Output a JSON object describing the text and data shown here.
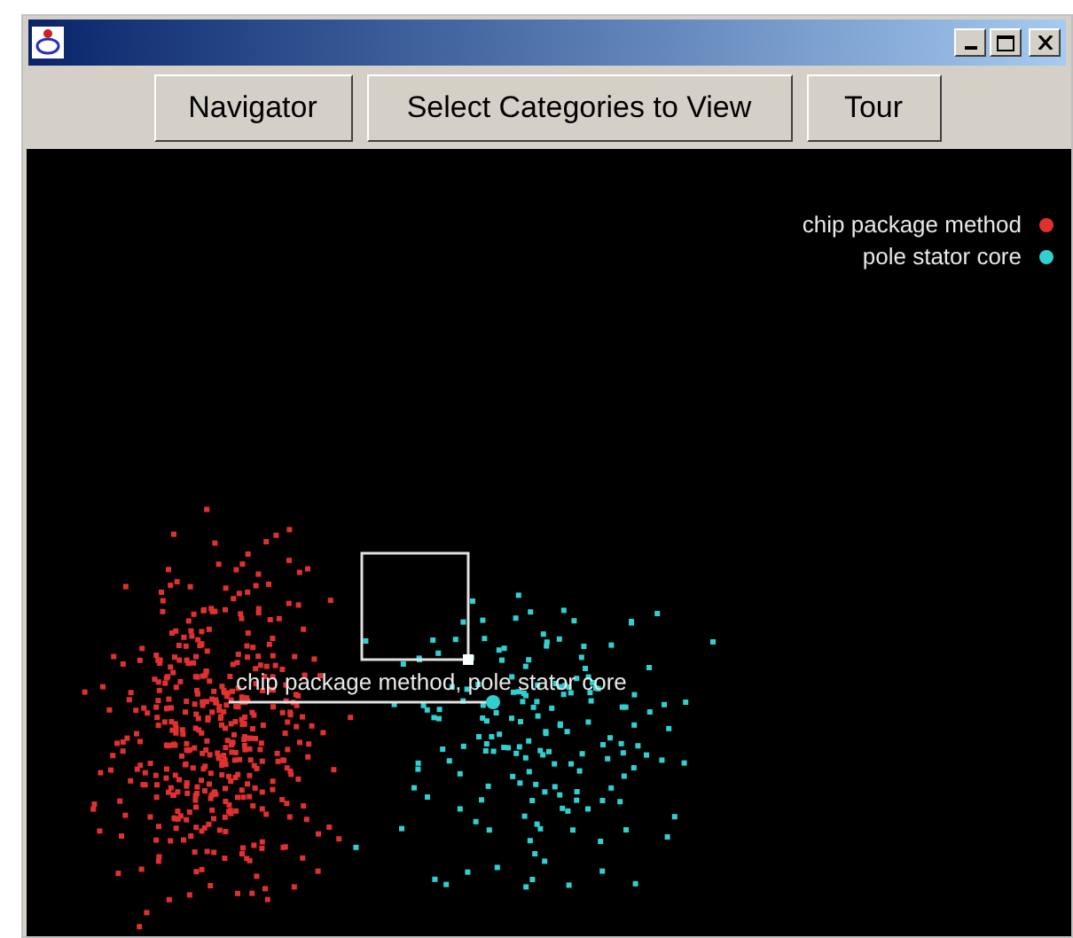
{
  "window": {
    "buttons": [
      "Navigator",
      "Select Categories to View",
      "Tour"
    ]
  },
  "plot": {
    "legend": [
      {
        "label": "chip package method",
        "color": "#e03030"
      },
      {
        "label": "pole stator core",
        "color": "#30d0d0"
      }
    ],
    "selection_label": "chip package method, pole stator core"
  }
}
